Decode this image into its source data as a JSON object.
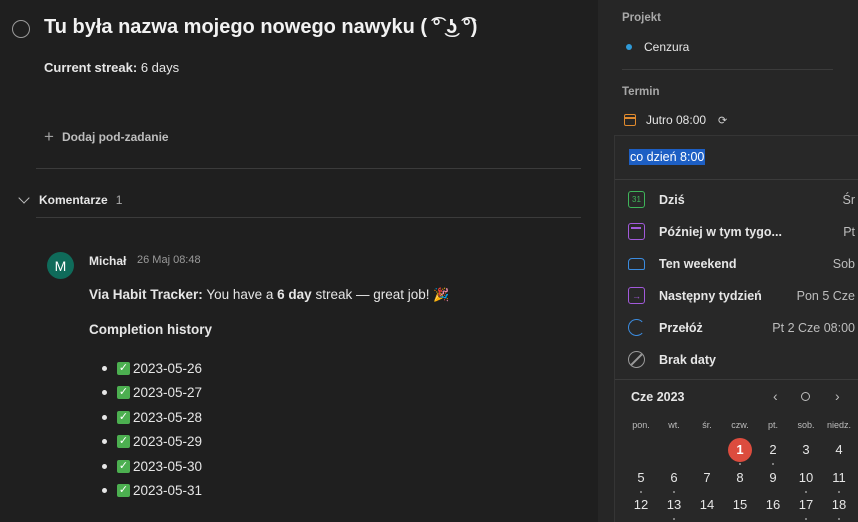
{
  "task": {
    "title": "Tu była nazwa mojego nowego nawyku ( ͡° ͜ʖ ͡°)",
    "streak_label": "Current streak:",
    "streak_value": "6 days",
    "add_subtask": "Dodaj pod-zadanie"
  },
  "comments": {
    "label": "Komentarze",
    "count": "1",
    "items": [
      {
        "avatar_letter": "M",
        "author": "Michał",
        "time": "26 Maj 08:48",
        "prefix": "Via Habit Tracker:",
        "text_before": "You have a",
        "streak_days": "6 day",
        "text_after": "streak — great job!",
        "history_title": "Completion history",
        "history": [
          "2023-05-26",
          "2023-05-27",
          "2023-05-28",
          "2023-05-29",
          "2023-05-30",
          "2023-05-31"
        ]
      }
    ]
  },
  "sidebar": {
    "project_label": "Projekt",
    "project_name": "Cenzura",
    "project_color": "#2f9ad8",
    "due_label": "Termin",
    "due_value": "Jutro 08:00"
  },
  "date_picker": {
    "input_value": "co dzień 8:00",
    "options": [
      {
        "label": "Dziś",
        "right": "Śr",
        "icon": "calendar-today-icon"
      },
      {
        "label": "Później w tym tygo...",
        "right": "Pt",
        "icon": "calendar-later-icon"
      },
      {
        "label": "Ten weekend",
        "right": "Sob",
        "icon": "sofa-icon"
      },
      {
        "label": "Następny tydzień",
        "right": "Pon 5 Cze",
        "icon": "calendar-next-icon"
      },
      {
        "label": "Przełóż",
        "right": "Pt 2 Cze 08:00",
        "icon": "reschedule-icon"
      },
      {
        "label": "Brak daty",
        "right": "",
        "icon": "no-date-icon"
      }
    ],
    "month": "Cze 2023",
    "weekdays": [
      "pon.",
      "wt.",
      "śr.",
      "czw.",
      "pt.",
      "sob.",
      "niedz."
    ],
    "week1": [
      "1",
      "2",
      "3",
      "4"
    ],
    "week2": [
      "5",
      "6",
      "7",
      "8",
      "9",
      "10",
      "11"
    ],
    "week3": [
      "12",
      "13",
      "14",
      "15",
      "16",
      "17",
      "18"
    ],
    "today": "1"
  }
}
